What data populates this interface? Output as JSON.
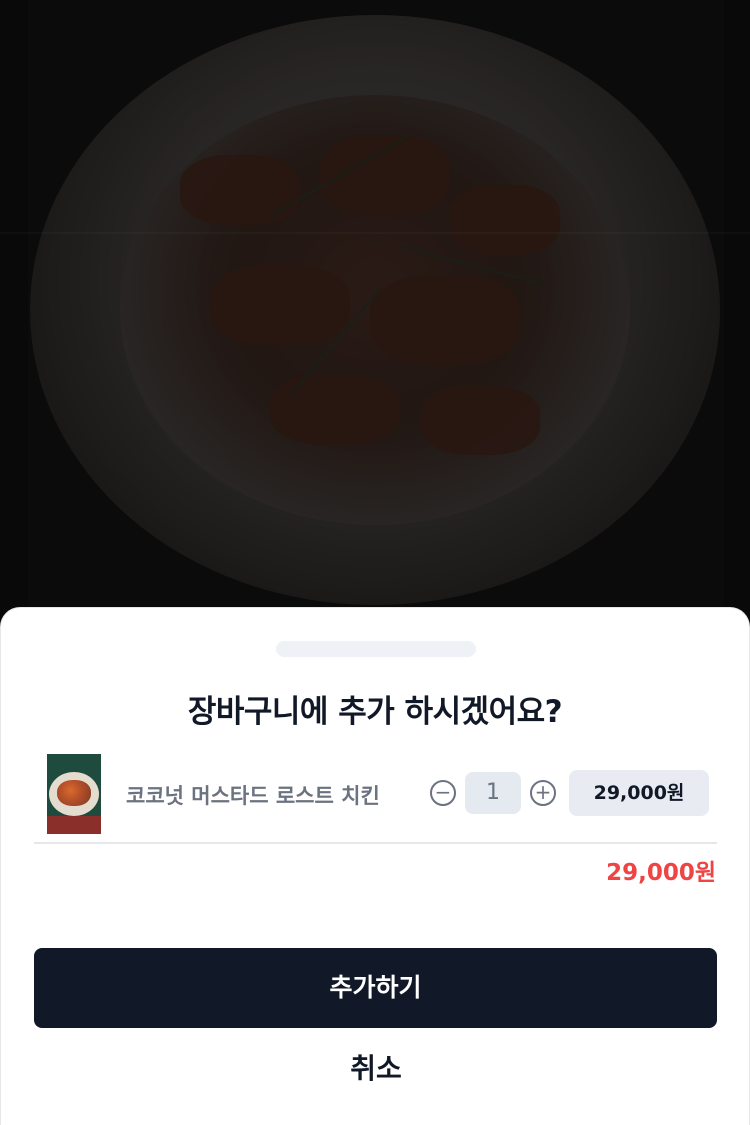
{
  "modal": {
    "title": "장바구니에 추가 하시겠어요?",
    "item": {
      "name": "코코넛 머스타드 로스트 치킨",
      "quantity": "1",
      "price": "29,000원",
      "minus_icon": "minus-circle-icon",
      "plus_icon": "plus-circle-icon",
      "minus_glyph": "−",
      "plus_glyph": "+"
    },
    "total": "29,000원",
    "add_label": "추가하기",
    "cancel_label": "취소"
  },
  "colors": {
    "primary": "#111827",
    "total_price": "#ef4444",
    "muted_text": "#6b7280"
  }
}
